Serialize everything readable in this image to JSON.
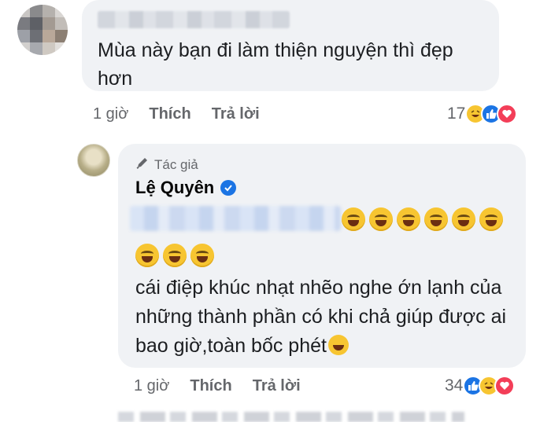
{
  "comment1": {
    "text": "Mùa này bạn đi làm thiện nguyện thì đẹp hơn",
    "time": "1 giờ",
    "like_label": "Thích",
    "reply_label": "Trả lời",
    "reaction_count": "17",
    "reactions": [
      "haha-icon",
      "like-icon",
      "love-icon"
    ]
  },
  "comment2": {
    "author_badge": "Tác giả",
    "author_name": "Lệ Quyên",
    "text": "cái điệp khúc nhạt nhẽo nghe ớn lạnh của những thành phần có khi chả giúp được ai bao giờ,toàn bốc phét",
    "time": "1 giờ",
    "like_label": "Thích",
    "reply_label": "Trả lời",
    "reaction_count": "34",
    "reactions": [
      "like-icon",
      "haha-icon",
      "love-icon"
    ]
  },
  "colors": {
    "bubble": "#f0f2f5",
    "meta_text": "#65676b",
    "like": "#1b74e4",
    "love": "#f33e58",
    "haha": "#f7c531"
  }
}
